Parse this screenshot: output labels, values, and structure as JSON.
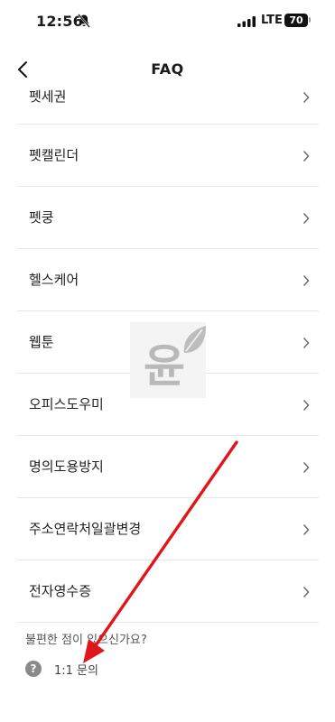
{
  "status_bar": {
    "time": "12:56",
    "network": "LTE",
    "battery": "70"
  },
  "nav": {
    "title": "FAQ"
  },
  "list": {
    "items": [
      {
        "label": "펫세권"
      },
      {
        "label": "펫캘린더"
      },
      {
        "label": "펫쿵"
      },
      {
        "label": "헬스케어"
      },
      {
        "label": "웹툰"
      },
      {
        "label": "오피스도우미"
      },
      {
        "label": "명의도용방지"
      },
      {
        "label": "주소연락처일괄변경"
      },
      {
        "label": "전자영수증"
      }
    ]
  },
  "help": {
    "prompt": "불편한 점이 있으신가요?",
    "inquiry_label": "1:1 문의",
    "inquiry_icon": "question-circle-icon"
  },
  "watermark": {
    "text": "윤"
  },
  "annotation": {
    "color": "#e0161b"
  }
}
